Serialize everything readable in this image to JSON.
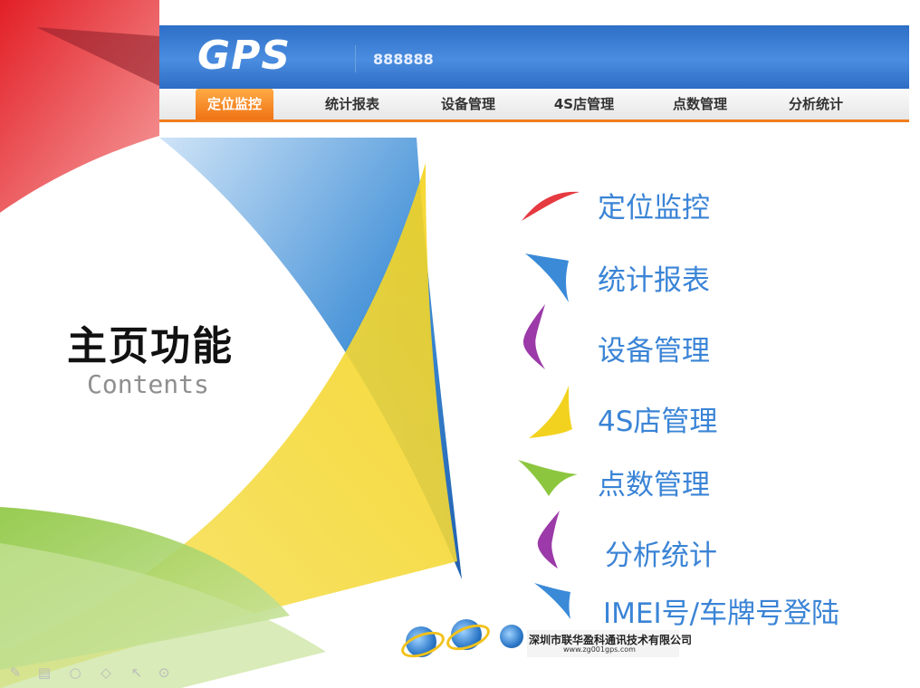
{
  "gps_header": {
    "logo": "GPS",
    "account": "888888",
    "tabs": [
      {
        "label": "定位监控",
        "active": true
      },
      {
        "label": "统计报表",
        "active": false
      },
      {
        "label": "设备管理",
        "active": false
      },
      {
        "label": "4S店管理",
        "active": false
      },
      {
        "label": "点数管理",
        "active": false
      },
      {
        "label": "分析统计",
        "active": false
      }
    ],
    "accent": "#f07d1d",
    "bar_color": "#3b7fd6"
  },
  "title": {
    "main": "主页功能",
    "sub": "Contents"
  },
  "menu": {
    "items": [
      {
        "label": "定位监控",
        "shape_color": "#e53a40"
      },
      {
        "label": "统计报表",
        "shape_color": "#3a8ad8"
      },
      {
        "label": "设备管理",
        "shape_color": "#9b3aa8"
      },
      {
        "label": "4S店管理",
        "shape_color": "#f2d21e"
      },
      {
        "label": "点数管理",
        "shape_color": "#8cc63e"
      },
      {
        "label": "分析统计",
        "shape_color": "#9b3aa8"
      },
      {
        "label": "IMEI号/车牌号登陆",
        "shape_color": "#3a8ad8"
      }
    ],
    "text_color": "#3a84d6"
  },
  "footer": {
    "company_name": "深圳市联华盈科通讯技术有限公司",
    "company_url": "www.zg001gps.com"
  },
  "toolbar": {
    "icons": [
      "pen-icon",
      "slides-icon",
      "circle-icon",
      "eraser-icon",
      "pointer-icon",
      "zoom-icon"
    ]
  }
}
